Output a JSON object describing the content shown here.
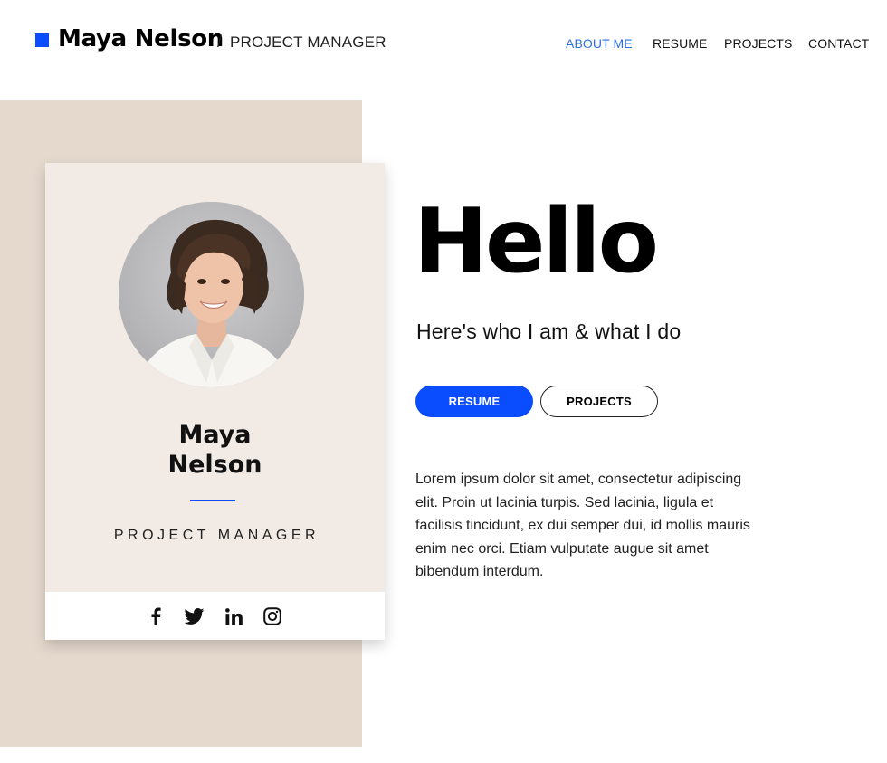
{
  "header": {
    "brand_name": "Maya Nelson",
    "separator": "/",
    "brand_role": "PROJECT MANAGER",
    "nav": [
      {
        "label": "ABOUT ME",
        "active": true
      },
      {
        "label": "RESUME",
        "active": false
      },
      {
        "label": "PROJECTS",
        "active": false
      },
      {
        "label": "CONTACT",
        "active": false
      }
    ]
  },
  "profile_card": {
    "first_name": "Maya",
    "last_name": "Nelson",
    "role": "PROJECT MANAGER",
    "social": [
      "facebook-icon",
      "twitter-icon",
      "linkedin-icon",
      "instagram-icon"
    ]
  },
  "hero": {
    "title": "Hello",
    "subtitle": "Here's who I am & what I do",
    "buttons": {
      "primary": "RESUME",
      "secondary": "PROJECTS"
    },
    "bio": "Lorem ipsum dolor sit amet, consectetur adipiscing elit. Proin ut lacinia turpis. Sed lacinia, ligula et facilisis tincidunt, ex dui semper dui, id mollis mauris enim nec orci. Etiam vulputate augue sit amet bibendum interdum."
  },
  "colors": {
    "accent": "#0a4dff",
    "nav_active": "#2f6fe0",
    "beige_panel": "#e5d9cd",
    "card_bg": "#f2ebe5"
  }
}
